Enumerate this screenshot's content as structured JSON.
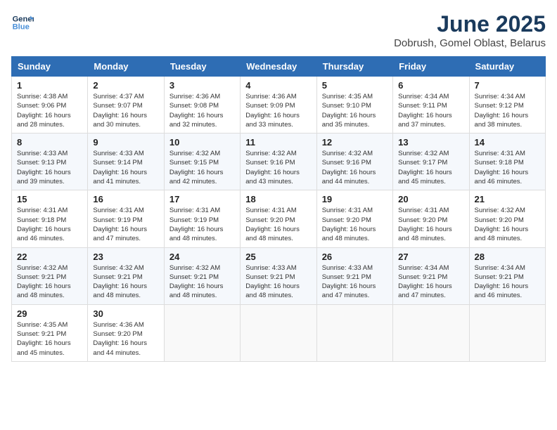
{
  "header": {
    "logo_line1": "General",
    "logo_line2": "Blue",
    "month": "June 2025",
    "location": "Dobrush, Gomel Oblast, Belarus"
  },
  "weekdays": [
    "Sunday",
    "Monday",
    "Tuesday",
    "Wednesday",
    "Thursday",
    "Friday",
    "Saturday"
  ],
  "weeks": [
    [
      {
        "day": "1",
        "sunrise": "Sunrise: 4:38 AM",
        "sunset": "Sunset: 9:06 PM",
        "daylight": "Daylight: 16 hours and 28 minutes."
      },
      {
        "day": "2",
        "sunrise": "Sunrise: 4:37 AM",
        "sunset": "Sunset: 9:07 PM",
        "daylight": "Daylight: 16 hours and 30 minutes."
      },
      {
        "day": "3",
        "sunrise": "Sunrise: 4:36 AM",
        "sunset": "Sunset: 9:08 PM",
        "daylight": "Daylight: 16 hours and 32 minutes."
      },
      {
        "day": "4",
        "sunrise": "Sunrise: 4:36 AM",
        "sunset": "Sunset: 9:09 PM",
        "daylight": "Daylight: 16 hours and 33 minutes."
      },
      {
        "day": "5",
        "sunrise": "Sunrise: 4:35 AM",
        "sunset": "Sunset: 9:10 PM",
        "daylight": "Daylight: 16 hours and 35 minutes."
      },
      {
        "day": "6",
        "sunrise": "Sunrise: 4:34 AM",
        "sunset": "Sunset: 9:11 PM",
        "daylight": "Daylight: 16 hours and 37 minutes."
      },
      {
        "day": "7",
        "sunrise": "Sunrise: 4:34 AM",
        "sunset": "Sunset: 9:12 PM",
        "daylight": "Daylight: 16 hours and 38 minutes."
      }
    ],
    [
      {
        "day": "8",
        "sunrise": "Sunrise: 4:33 AM",
        "sunset": "Sunset: 9:13 PM",
        "daylight": "Daylight: 16 hours and 39 minutes."
      },
      {
        "day": "9",
        "sunrise": "Sunrise: 4:33 AM",
        "sunset": "Sunset: 9:14 PM",
        "daylight": "Daylight: 16 hours and 41 minutes."
      },
      {
        "day": "10",
        "sunrise": "Sunrise: 4:32 AM",
        "sunset": "Sunset: 9:15 PM",
        "daylight": "Daylight: 16 hours and 42 minutes."
      },
      {
        "day": "11",
        "sunrise": "Sunrise: 4:32 AM",
        "sunset": "Sunset: 9:16 PM",
        "daylight": "Daylight: 16 hours and 43 minutes."
      },
      {
        "day": "12",
        "sunrise": "Sunrise: 4:32 AM",
        "sunset": "Sunset: 9:16 PM",
        "daylight": "Daylight: 16 hours and 44 minutes."
      },
      {
        "day": "13",
        "sunrise": "Sunrise: 4:32 AM",
        "sunset": "Sunset: 9:17 PM",
        "daylight": "Daylight: 16 hours and 45 minutes."
      },
      {
        "day": "14",
        "sunrise": "Sunrise: 4:31 AM",
        "sunset": "Sunset: 9:18 PM",
        "daylight": "Daylight: 16 hours and 46 minutes."
      }
    ],
    [
      {
        "day": "15",
        "sunrise": "Sunrise: 4:31 AM",
        "sunset": "Sunset: 9:18 PM",
        "daylight": "Daylight: 16 hours and 46 minutes."
      },
      {
        "day": "16",
        "sunrise": "Sunrise: 4:31 AM",
        "sunset": "Sunset: 9:19 PM",
        "daylight": "Daylight: 16 hours and 47 minutes."
      },
      {
        "day": "17",
        "sunrise": "Sunrise: 4:31 AM",
        "sunset": "Sunset: 9:19 PM",
        "daylight": "Daylight: 16 hours and 48 minutes."
      },
      {
        "day": "18",
        "sunrise": "Sunrise: 4:31 AM",
        "sunset": "Sunset: 9:20 PM",
        "daylight": "Daylight: 16 hours and 48 minutes."
      },
      {
        "day": "19",
        "sunrise": "Sunrise: 4:31 AM",
        "sunset": "Sunset: 9:20 PM",
        "daylight": "Daylight: 16 hours and 48 minutes."
      },
      {
        "day": "20",
        "sunrise": "Sunrise: 4:31 AM",
        "sunset": "Sunset: 9:20 PM",
        "daylight": "Daylight: 16 hours and 48 minutes."
      },
      {
        "day": "21",
        "sunrise": "Sunrise: 4:32 AM",
        "sunset": "Sunset: 9:20 PM",
        "daylight": "Daylight: 16 hours and 48 minutes."
      }
    ],
    [
      {
        "day": "22",
        "sunrise": "Sunrise: 4:32 AM",
        "sunset": "Sunset: 9:21 PM",
        "daylight": "Daylight: 16 hours and 48 minutes."
      },
      {
        "day": "23",
        "sunrise": "Sunrise: 4:32 AM",
        "sunset": "Sunset: 9:21 PM",
        "daylight": "Daylight: 16 hours and 48 minutes."
      },
      {
        "day": "24",
        "sunrise": "Sunrise: 4:32 AM",
        "sunset": "Sunset: 9:21 PM",
        "daylight": "Daylight: 16 hours and 48 minutes."
      },
      {
        "day": "25",
        "sunrise": "Sunrise: 4:33 AM",
        "sunset": "Sunset: 9:21 PM",
        "daylight": "Daylight: 16 hours and 48 minutes."
      },
      {
        "day": "26",
        "sunrise": "Sunrise: 4:33 AM",
        "sunset": "Sunset: 9:21 PM",
        "daylight": "Daylight: 16 hours and 47 minutes."
      },
      {
        "day": "27",
        "sunrise": "Sunrise: 4:34 AM",
        "sunset": "Sunset: 9:21 PM",
        "daylight": "Daylight: 16 hours and 47 minutes."
      },
      {
        "day": "28",
        "sunrise": "Sunrise: 4:34 AM",
        "sunset": "Sunset: 9:21 PM",
        "daylight": "Daylight: 16 hours and 46 minutes."
      }
    ],
    [
      {
        "day": "29",
        "sunrise": "Sunrise: 4:35 AM",
        "sunset": "Sunset: 9:21 PM",
        "daylight": "Daylight: 16 hours and 45 minutes."
      },
      {
        "day": "30",
        "sunrise": "Sunrise: 4:36 AM",
        "sunset": "Sunset: 9:20 PM",
        "daylight": "Daylight: 16 hours and 44 minutes."
      },
      null,
      null,
      null,
      null,
      null
    ]
  ]
}
